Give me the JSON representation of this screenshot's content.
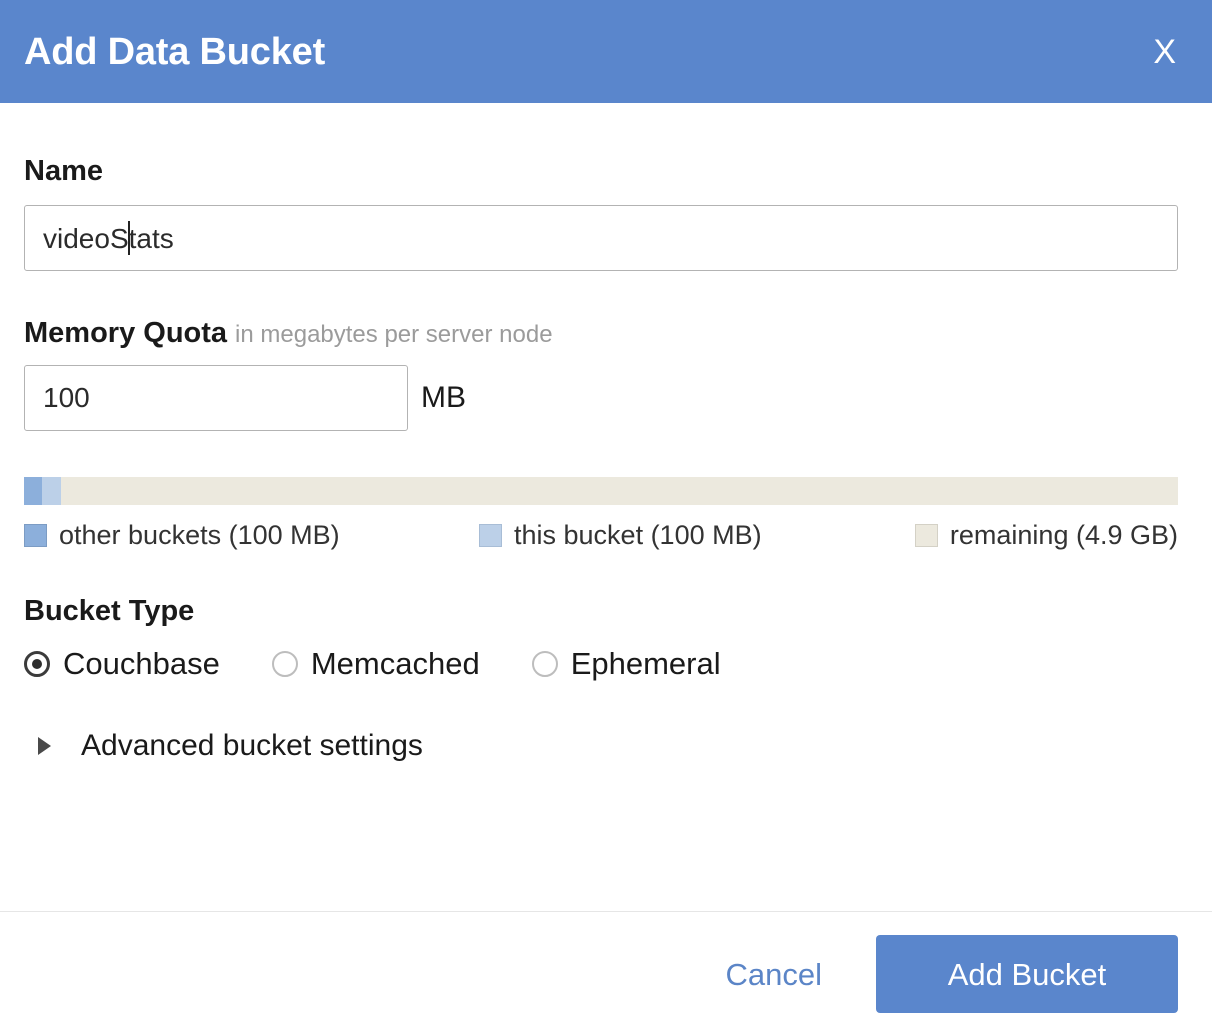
{
  "dialog": {
    "title": "Add Data Bucket",
    "close_label": "X"
  },
  "name_field": {
    "label": "Name",
    "value_before_caret": "videoS",
    "value_after_caret": "tats",
    "value": "videoStats",
    "placeholder": ""
  },
  "memory_quota": {
    "label": "Memory Quota",
    "hint": "in megabytes per server node",
    "value": "100",
    "unit": "MB",
    "placeholder": ""
  },
  "quota_bar": {
    "segments": [
      {
        "name": "other buckets",
        "amount": "100 MB",
        "percent": 1.6,
        "color": "#8cafdb"
      },
      {
        "name": "this bucket",
        "amount": "100 MB",
        "percent": 1.6,
        "color": "#bcd0e8"
      },
      {
        "name": "remaining",
        "amount": "4.9 GB",
        "percent": 96.8,
        "color": "#ece9de"
      }
    ],
    "legend": [
      "other buckets (100 MB)",
      "this bucket (100 MB)",
      "remaining (4.9 GB)"
    ]
  },
  "bucket_type": {
    "label": "Bucket Type",
    "selected": "Couchbase",
    "options": [
      {
        "label": "Couchbase",
        "selected": true
      },
      {
        "label": "Memcached",
        "selected": false
      },
      {
        "label": "Ephemeral",
        "selected": false
      }
    ]
  },
  "advanced": {
    "label": "Advanced bucket settings",
    "expanded": false
  },
  "footer": {
    "cancel_label": "Cancel",
    "submit_label": "Add Bucket"
  },
  "colors": {
    "header_blue": "#5a86cc",
    "primary_blue": "#5a86cc",
    "link_blue": "#5b85c7",
    "other_buckets": "#8cafdb",
    "this_bucket": "#bcd0e8",
    "remaining": "#ece9de"
  }
}
